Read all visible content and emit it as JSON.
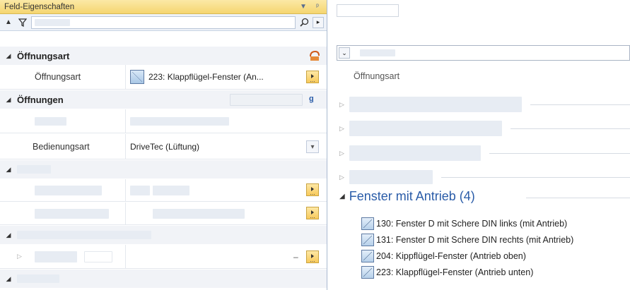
{
  "panel": {
    "title": "Feld-Eigenschaften",
    "pin_icon": "pin-icon",
    "dropdown_icon": "chevron-down-icon"
  },
  "toolbar": {
    "collapse_icon": "collapse-up-icon",
    "filter_icon": "filter-icon",
    "search_icon": "search-icon",
    "next_icon": "arrow-right-icon"
  },
  "properties": {
    "cat1": {
      "label": "Öffnungsart"
    },
    "prop1": {
      "name": "Öffnungsart",
      "value": "223: Klappflügel-Fenster (An..."
    },
    "cat2": {
      "label": "Öffnungen"
    },
    "prop2": {
      "name": "Bedienungsart",
      "value": "DriveTec (Lüftung)"
    },
    "ellipsis": "..."
  },
  "right": {
    "group_hint": "Öffnungsart",
    "group": {
      "title": "Fenster mit Antrieb (4)",
      "items": [
        "130: Fenster D mit Schere DIN links (mit Antrieb)",
        "131: Fenster D mit Schere DIN rechts (mit Antrieb)",
        "204: Kippflügel-Fenster (Antrieb oben)",
        "223: Klappflügel-Fenster (Antrieb unten)"
      ]
    }
  },
  "colors": {
    "titlebar": "#f5d670",
    "group_title": "#2a5ca8",
    "category_bg": "#f1f3f7"
  }
}
